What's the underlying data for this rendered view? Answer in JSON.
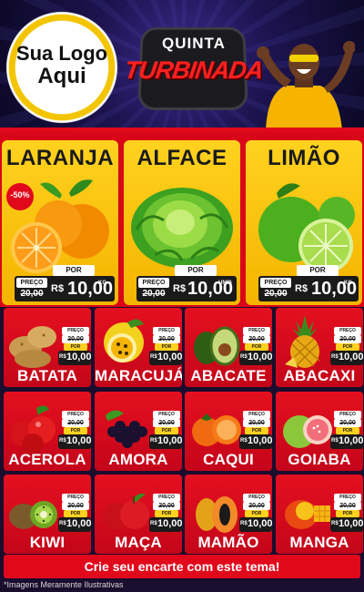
{
  "logo": {
    "line1": "Sua Logo",
    "line2": "Aqui"
  },
  "badge": {
    "top": "QUINTA",
    "bottom": "TURBINADA"
  },
  "top_products": [
    {
      "name": "LARANJA",
      "discount": "-50%",
      "por": "POR",
      "preco": "PREÇO",
      "old_price": "20,00",
      "currency": "R$",
      "price": "10,00",
      "unit": "KG",
      "icon": "orange-icon"
    },
    {
      "name": "ALFACE",
      "por": "POR",
      "preco": "PREÇO",
      "old_price": "20,00",
      "currency": "R$",
      "price": "10,00",
      "unit": "UNID",
      "icon": "lettuce-icon"
    },
    {
      "name": "LIMÃO",
      "por": "POR",
      "preco": "PREÇO",
      "old_price": "20,00",
      "currency": "R$",
      "price": "10,00",
      "unit": "KG",
      "icon": "lime-icon"
    }
  ],
  "products": [
    {
      "name": "BATATA",
      "icon": "potato-icon"
    },
    {
      "name": "MARACUJÁ",
      "icon": "passionfruit-icon"
    },
    {
      "name": "ABACATE",
      "icon": "avocado-icon"
    },
    {
      "name": "ABACAXI",
      "icon": "pineapple-icon"
    },
    {
      "name": "ACEROLA",
      "icon": "acerola-icon"
    },
    {
      "name": "AMORA",
      "icon": "blackberry-icon"
    },
    {
      "name": "CAQUI",
      "icon": "persimmon-icon"
    },
    {
      "name": "GOIABA",
      "icon": "guava-icon"
    },
    {
      "name": "KIWI",
      "icon": "kiwi-icon"
    },
    {
      "name": "MAÇA",
      "icon": "apple-icon"
    },
    {
      "name": "MAMÃO",
      "icon": "papaya-icon"
    },
    {
      "name": "MANGA",
      "icon": "mango-icon"
    }
  ],
  "small_price": {
    "preco": "PREÇO",
    "old_price": "20,00",
    "por": "POR",
    "currency": "R$",
    "price": "10,00",
    "unit": "KG"
  },
  "footer": {
    "cta": "Crie seu encarte com este tema!",
    "disclaimer": "*Imagens Meramente Ilustrativas"
  },
  "colors": {
    "red": "#e1081c",
    "yellow": "#f4b400",
    "dark": "#1a1a1a",
    "navy": "#1d1450"
  }
}
